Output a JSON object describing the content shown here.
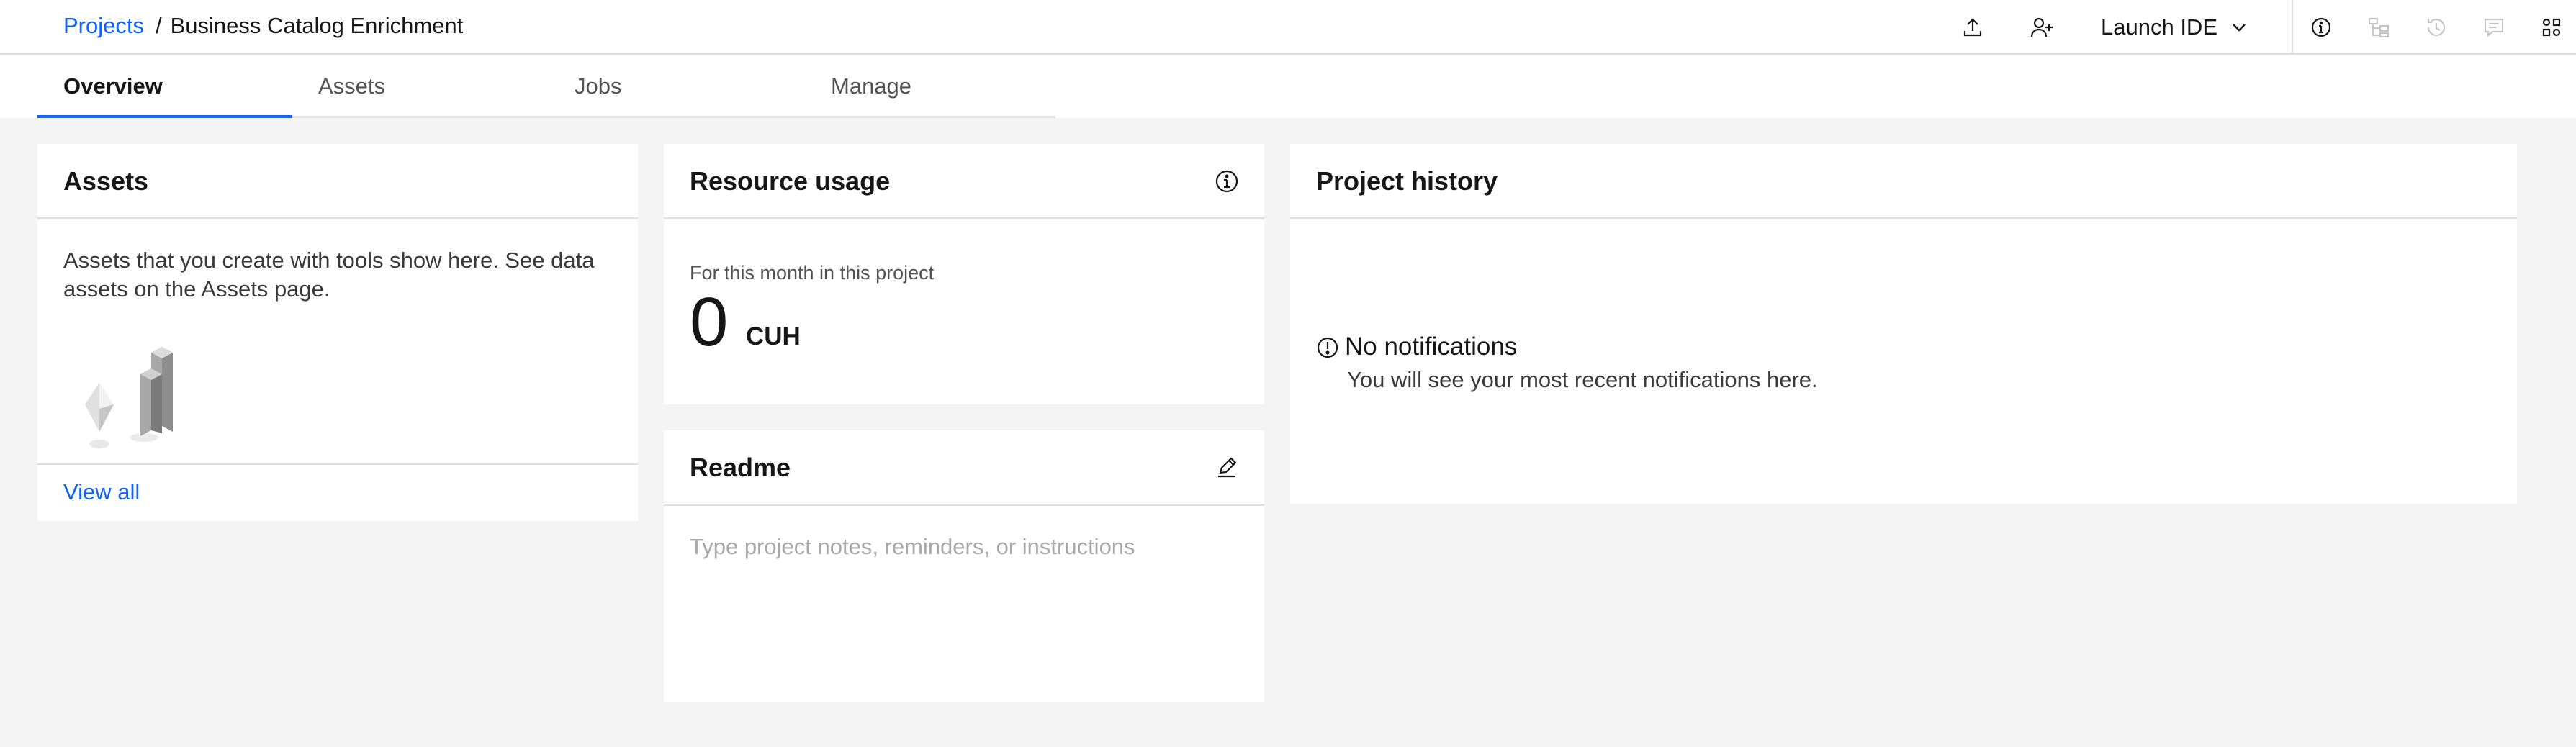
{
  "header": {
    "breadcrumb_root": "Projects",
    "breadcrumb_separator": "/",
    "project_name": "Business Catalog Enrichment",
    "launch_label": "Launch IDE",
    "icons": [
      "upload-icon",
      "add-collaborator-icon",
      "chevron-down-icon",
      "info-icon",
      "lineage-icon",
      "history-icon",
      "comment-icon",
      "apps-icon"
    ]
  },
  "tabs": [
    {
      "label": "Overview",
      "active": true
    },
    {
      "label": "Assets",
      "active": false
    },
    {
      "label": "Jobs",
      "active": false
    },
    {
      "label": "Manage",
      "active": false
    }
  ],
  "assets_card": {
    "title": "Assets",
    "description": "Assets that you create with tools show here. See data assets on the Assets page.",
    "view_all": "View all"
  },
  "resource_card": {
    "title": "Resource usage",
    "subtitle": "For this month in this project",
    "value": "0",
    "unit": "CUH"
  },
  "readme_card": {
    "title": "Readme",
    "placeholder": "Type project notes, reminders, or instructions"
  },
  "history_card": {
    "title": "Project history",
    "empty_title": "No notifications",
    "empty_text": "You will see your most recent notifications here."
  },
  "colors": {
    "accent": "#0f62fe",
    "background": "#f4f4f4",
    "surface": "#ffffff",
    "border": "#e0e0e0"
  }
}
